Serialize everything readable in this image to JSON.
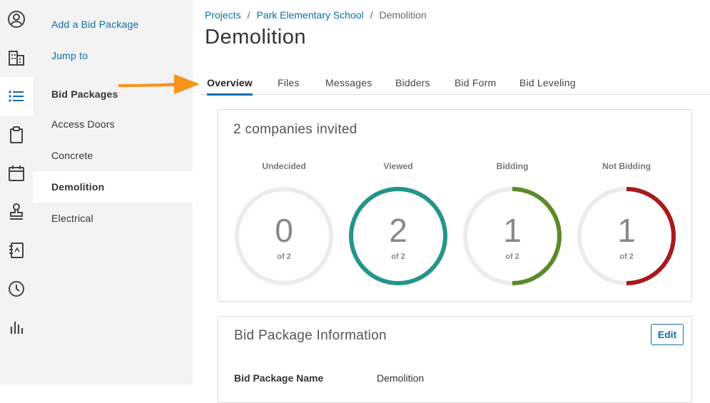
{
  "rail": {
    "items": [
      {
        "icon": "user-circle-icon"
      },
      {
        "icon": "building-icon"
      },
      {
        "icon": "list-icon",
        "active": true
      },
      {
        "icon": "clipboard-icon"
      },
      {
        "icon": "calendar-icon"
      },
      {
        "icon": "stamp-icon"
      },
      {
        "icon": "notebook-icon"
      },
      {
        "icon": "clock-icon"
      },
      {
        "icon": "bar-chart-icon"
      }
    ]
  },
  "sidebar": {
    "add_label": "Add a Bid Package",
    "jump_label": "Jump to",
    "heading": "Bid Packages",
    "items": [
      {
        "label": "Access Doors"
      },
      {
        "label": "Concrete"
      },
      {
        "label": "Demolition",
        "active": true
      },
      {
        "label": "Electrical"
      }
    ]
  },
  "breadcrumb": {
    "items": [
      "Projects",
      "Park Elementary School",
      "Demolition"
    ],
    "separator": "/"
  },
  "page": {
    "title": "Demolition"
  },
  "tabs": [
    "Overview",
    "Files",
    "Messages",
    "Bidders",
    "Bid Form",
    "Bid Leveling"
  ],
  "colors": {
    "accent": "#0b6ea8",
    "viewed": "#23958a",
    "bidding": "#5c8a2a",
    "not_bidding": "#a8191e",
    "track": "#ececec",
    "annotation_arrow": "#f7941d"
  },
  "invites": {
    "title": "2 companies invited",
    "stats": [
      {
        "label": "Undecided",
        "value": "0",
        "of": "of 2",
        "fraction": 0,
        "color": "#ececec"
      },
      {
        "label": "Viewed",
        "value": "2",
        "of": "of 2",
        "fraction": 1,
        "color": "#23958a"
      },
      {
        "label": "Bidding",
        "value": "1",
        "of": "of 2",
        "fraction": 0.5,
        "color": "#5c8a2a"
      },
      {
        "label": "Not Bidding",
        "value": "1",
        "of": "of 2",
        "fraction": 0.5,
        "color": "#a8191e"
      }
    ]
  },
  "info": {
    "title": "Bid Package Information",
    "edit_label": "Edit",
    "name_label": "Bid Package Name",
    "name_value": "Demolition"
  }
}
